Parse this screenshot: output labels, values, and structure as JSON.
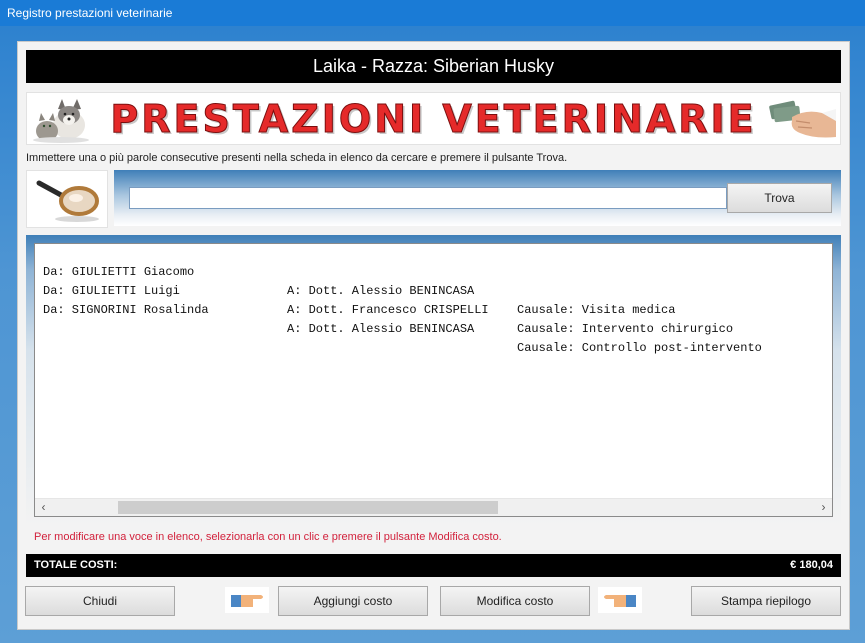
{
  "window": {
    "title": "Registro prestazioni veterinarie"
  },
  "header": {
    "title": "Laika  -  Razza: Siberian Husky"
  },
  "banner": {
    "title": "PRESTAZIONI VETERINARIE"
  },
  "search": {
    "instruction": "Immettere una o più parole consecutive presenti nella scheda in elenco da cercare e premere il pulsante Trova.",
    "value": "",
    "button_label": "Trova"
  },
  "list": {
    "rows": [
      {
        "da": "Da: GIULIETTI Giacomo",
        "a": "A: Dott. Alessio BENINCASA",
        "causale": "Causale: Visita medica"
      },
      {
        "da": "Da: GIULIETTI Luigi",
        "a": "A: Dott. Francesco CRISPELLI",
        "causale": "Causale: Intervento chirurgico"
      },
      {
        "da": "Da: SIGNORINI Rosalinda",
        "a": "A: Dott. Alessio BENINCASA",
        "causale": "Causale: Controllo post-intervento"
      }
    ]
  },
  "hint": "Per modificare una voce in elenco, selezionarla con un clic e premere il pulsante Modifica costo.",
  "totale": {
    "label": "TOTALE COSTI:",
    "value": "€ 180,04"
  },
  "buttons": {
    "chiudi": "Chiudi",
    "aggiungi": "Aggiungi costo",
    "modifica": "Modifica costo",
    "stampa": "Stampa riepilogo"
  },
  "icons": {
    "pets": "dog-cat-image",
    "money": "hand-money-image",
    "lens": "magnifier-icon",
    "pointer": "pointing-hand-icon"
  },
  "colors": {
    "titlebar": "#1a7bd6",
    "banner_text": "#e52a2a",
    "hint_text": "#d2223c",
    "header_bg": "#000000"
  }
}
